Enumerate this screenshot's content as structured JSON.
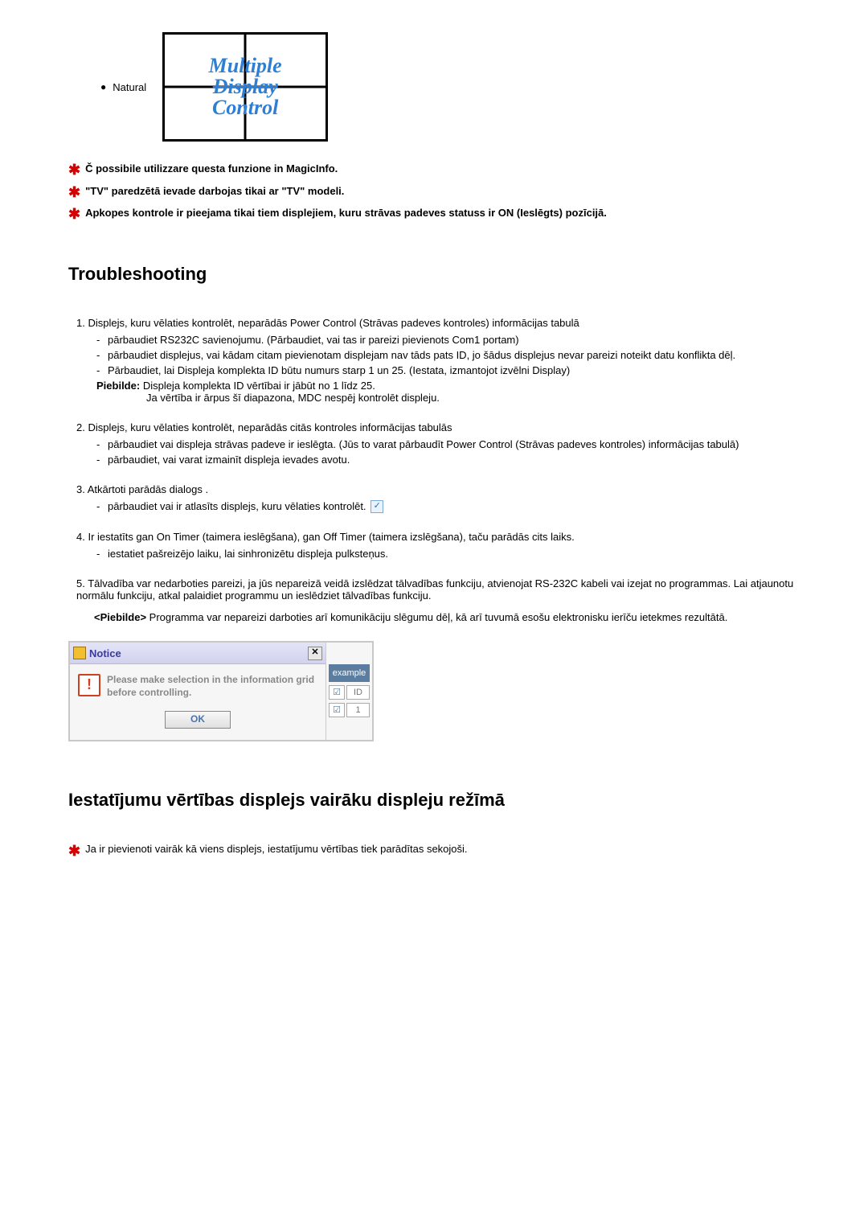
{
  "natural": {
    "label": "Natural",
    "bullet": "●"
  },
  "logo": {
    "line1": "Multiple",
    "line2": "Display",
    "line3": "Control"
  },
  "top_notes": [
    "Č possibile utilizzare questa funzione in MagicInfo.",
    "\"TV\" paredzētā ievade darbojas tikai ar \"TV\" modeli.",
    "Apkopes kontrole ir pieejama tikai tiem displejiem, kuru strāvas padeves statuss ir ON (Ieslēgts) pozīcijā."
  ],
  "troubleshooting_heading": "Troubleshooting",
  "ts": {
    "i1": {
      "num": "1.",
      "main": "Displejs, kuru vēlaties kontrolēt, neparādās Power Control (Strāvas padeves kontroles) informācijas tabulā",
      "s1": "pārbaudiet RS232C savienojumu. (Pārbaudiet, vai tas ir pareizi pievienots Com1 portam)",
      "s2": "pārbaudiet displejus, vai kādam citam pievienotam displejam nav tāds pats ID, jo šādus displejus nevar pareizi noteikt datu konflikta dēļ.",
      "s3": "Pārbaudiet, lai Displeja komplekta ID būtu numurs starp 1 un 25. (Iestata, izmantojot izvēlni Display)",
      "piebilde_label": "Piebilde:",
      "piebilde_l1": "Displeja komplekta ID vērtībai ir jābūt no 1 līdz 25.",
      "piebilde_l2": "Ja vērtība ir ārpus šī diapazona, MDC nespēj kontrolēt displeju."
    },
    "i2": {
      "num": "2.",
      "main": "Displejs, kuru vēlaties kontrolēt, neparādās citās kontroles informācijas tabulās",
      "s1": "pārbaudiet vai displeja strāvas padeve ir ieslēgta. (Jūs to varat pārbaudīt Power Control (Strāvas padeves kontroles) informācijas tabulā)",
      "s2": "pārbaudiet, vai varat izmainīt displeja ievades avotu."
    },
    "i3": {
      "num": "3.",
      "main": "Atkārtoti parādās dialogs .",
      "s1": "pārbaudiet vai ir atlasīts displejs, kuru vēlaties kontrolēt."
    },
    "i4": {
      "num": "4.",
      "main": "Ir iestatīts gan On Timer (taimera ieslēgšana), gan Off Timer (taimera izslēgšana), taču parādās cits laiks.",
      "s1": "iestatiet pašreizējo laiku, lai sinhronizētu displeja pulksteņus."
    },
    "i5": {
      "num": "5.",
      "main": "Tālvadība var nedarboties pareizi, ja jūs nepareizā veidā izslēdzat tālvadības funkciju, atvienojat RS-232C kabeli vai izejat no programmas. Lai atjaunotu normālu funkciju, atkal palaidiet programmu un ieslēdziet tālvadības funkciju.",
      "piebilde_label": "<Piebilde>",
      "piebilde": "Programma var nepareizi darboties arī komunikāciju slēgumu dēļ, kā arī tuvumā esošu elektronisku ierīču ietekmes rezultātā."
    }
  },
  "notice": {
    "title": "Notice",
    "close": "✕",
    "warn": "!",
    "msg": "Please make selection in the information grid before controlling.",
    "ok": "OK",
    "example_label": "example",
    "check": "☑",
    "id_label": "ID",
    "id_val": "1"
  },
  "settings_heading": "Iestatījumu vērtības displejs vairāku displeju režīmā",
  "settings_note": "Ja ir pievienoti vairāk kā viens displejs, iestatījumu vērtības tiek parādītas sekojoši."
}
